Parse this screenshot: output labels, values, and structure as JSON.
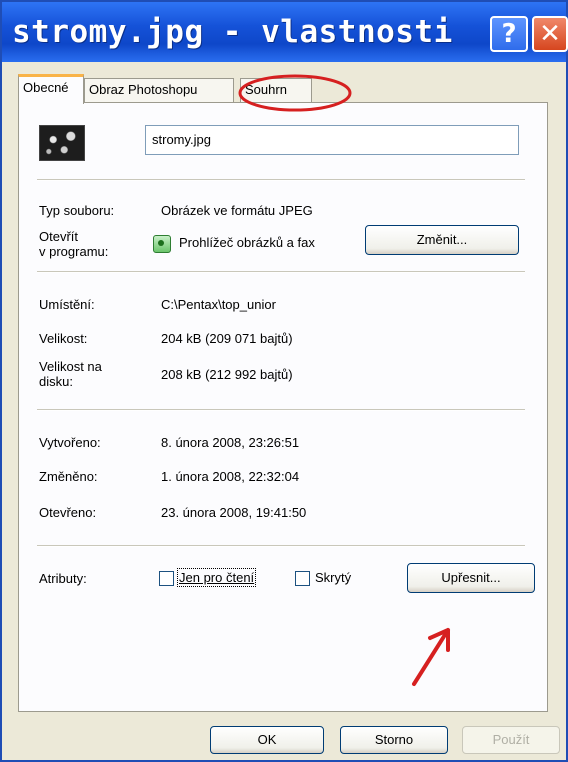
{
  "window": {
    "title": "stromy.jpg - vlastnosti",
    "help_label": "?",
    "close_label": "✕"
  },
  "tabs": [
    {
      "label": "Obecné",
      "active": true
    },
    {
      "label": "Obraz Photoshopu",
      "active": false
    },
    {
      "label": "Souhrn",
      "active": false
    }
  ],
  "file": {
    "name": "stromy.jpg",
    "thumbnail_icon": "jpeg-thumbnail-icon"
  },
  "fields": {
    "type_label": "Typ souboru:",
    "type_value": "Obrázek ve formátu JPEG",
    "open_with_label_1": "Otevřít",
    "open_with_label_2": "v programu:",
    "open_with_value": "Prohlížeč obrázků a fax",
    "open_with_icon": "image-viewer-icon",
    "change_button": "Změnit...",
    "location_label": "Umístění:",
    "location_value": "C:\\Pentax\\top_unior",
    "size_label": "Velikost:",
    "size_value": "204 kB (209 071 bajtů)",
    "size_on_disk_label_1": "Velikost na",
    "size_on_disk_label_2": "disku:",
    "size_on_disk_value": "208 kB (212 992 bajtů)",
    "created_label": "Vytvořeno:",
    "created_value": "8. února 2008, 23:26:51",
    "modified_label": "Změněno:",
    "modified_value": "1. února 2008, 22:32:04",
    "accessed_label": "Otevřeno:",
    "accessed_value": "23. února 2008, 19:41:50",
    "attributes_label": "Atributy:",
    "readonly_label": "Jen pro čtení",
    "readonly_checked": false,
    "hidden_label": "Skrytý",
    "hidden_checked": false,
    "advanced_button": "Upřesnit..."
  },
  "footer": {
    "ok": "OK",
    "cancel": "Storno",
    "apply": "Použít"
  },
  "annotations": {
    "circle_color": "#D62020",
    "arrow_color": "#D62020"
  }
}
